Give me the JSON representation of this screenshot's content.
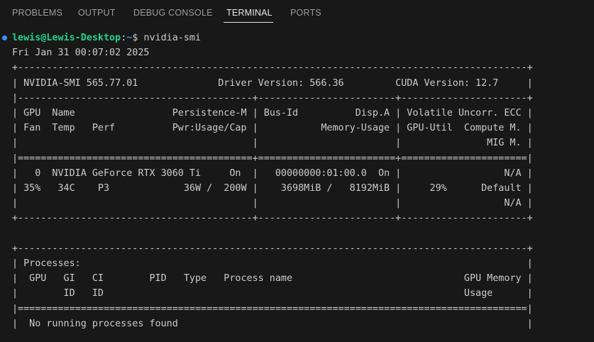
{
  "tabs": [
    {
      "label": "PROBLEMS",
      "active": false
    },
    {
      "label": "OUTPUT",
      "active": false
    },
    {
      "label": "DEBUG CONSOLE",
      "active": false
    },
    {
      "label": "TERMINAL",
      "active": true
    },
    {
      "label": "PORTS",
      "active": false
    }
  ],
  "prompt": {
    "user_host": "lewis@Lewis-Desktop",
    "separator": ":",
    "path": "~",
    "symbol": "$ ",
    "command": "nvidia-smi"
  },
  "output_lines": [
    "Fri Jan 31 00:07:02 2025",
    "+-----------------------------------------------------------------------------------------+",
    "| NVIDIA-SMI 565.77.01              Driver Version: 566.36         CUDA Version: 12.7     |",
    "|-----------------------------------------+------------------------+----------------------+",
    "| GPU  Name                 Persistence-M | Bus-Id          Disp.A | Volatile Uncorr. ECC |",
    "| Fan  Temp   Perf          Pwr:Usage/Cap |           Memory-Usage | GPU-Util  Compute M. |",
    "|                                         |                        |               MIG M. |",
    "|=========================================+========================+======================|",
    "|   0  NVIDIA GeForce RTX 3060 Ti     On  |   00000000:01:00.0  On |                  N/A |",
    "| 35%   34C    P3             36W /  200W |    3698MiB /   8192MiB |     29%      Default |",
    "|                                         |                        |                  N/A |",
    "+-----------------------------------------+------------------------+----------------------+",
    "",
    "+-----------------------------------------------------------------------------------------+",
    "| Processes:                                                                              |",
    "|  GPU   GI   CI        PID   Type   Process name                              GPU Memory |",
    "|        ID   ID                                                               Usage      |",
    "|=========================================================================================|",
    "|  No running processes found                                                             |"
  ]
}
